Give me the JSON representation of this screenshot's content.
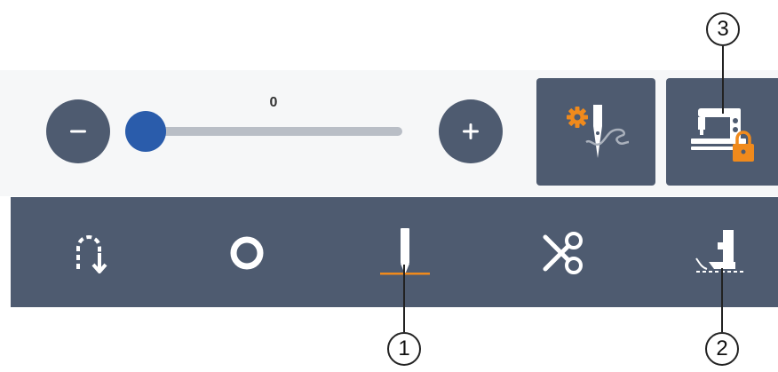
{
  "slider": {
    "value": 0,
    "label": "0",
    "decrease_icon": "minus-icon",
    "increase_icon": "plus-icon"
  },
  "buttons": {
    "stitch_settings_icon": "needle-settings-icon",
    "machine_lock_icon": "sewing-machine-lock-icon"
  },
  "toolbar": {
    "items": [
      "reverse-stitch-icon",
      "tie-off-icon",
      "needle-stop-position-icon",
      "thread-cutter-icon",
      "presser-foot-icon"
    ]
  },
  "callouts": [
    "1",
    "2",
    "3"
  ],
  "colors": {
    "panel": "#4e5b70",
    "accent_orange": "#f08a1c",
    "slider_thumb": "#2a5cab",
    "slider_track": "#b9bec6"
  }
}
